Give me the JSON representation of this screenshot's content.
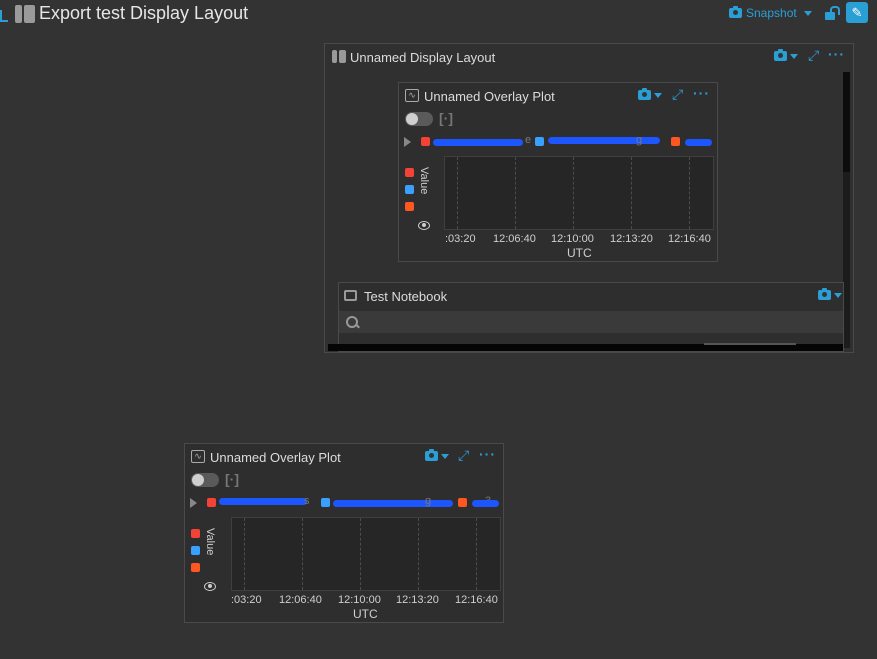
{
  "header": {
    "title": "Export test Display Layout",
    "snapshot_label": "Snapshot"
  },
  "display_layout": {
    "title": "Unnamed Display Layout",
    "notebook_title": "Test Notebook",
    "search_placeholder": ""
  },
  "plot": {
    "title": "Unnamed Overlay Plot",
    "y_label": "Value",
    "x_label": "UTC",
    "ticks": [
      ":03:20",
      "12:06:40",
      "12:10:00",
      "12:13:20",
      "12:16:40"
    ],
    "series_colors": [
      "#f44336",
      "#3aa0ff",
      "#ff5722"
    ],
    "legend_tail_1": "e",
    "legend_tail_2": "g",
    "legend_tail_3": "3"
  },
  "plot2": {
    "title": "Unnamed Overlay Plot",
    "y_label": "Value",
    "x_label": "UTC",
    "ticks": [
      ":03:20",
      "12:06:40",
      "12:10:00",
      "12:13:20",
      "12:16:40"
    ],
    "legend_tail_1": "s",
    "legend_tail_2": "g",
    "legend_tail_3": "3"
  },
  "colors": {
    "accent": "#2a9fd6",
    "background": "#333333",
    "redaction": "#1d55ff"
  }
}
